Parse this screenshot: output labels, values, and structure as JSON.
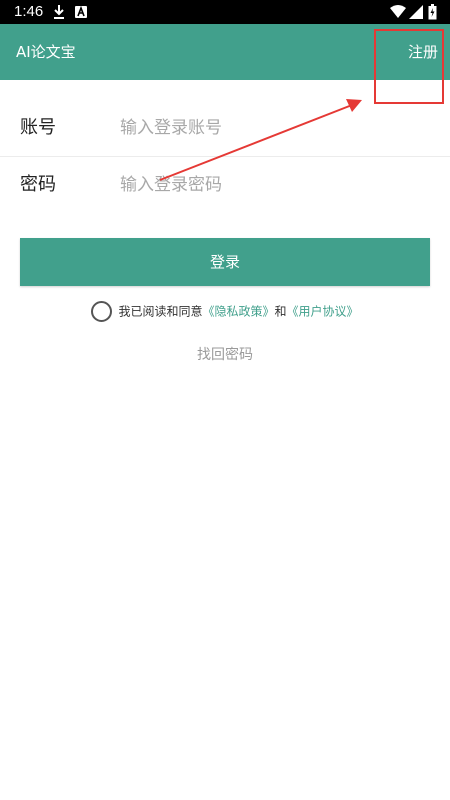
{
  "status_bar": {
    "time": "1:46",
    "icons": [
      "download-icon",
      "a-notification-icon",
      "wifi-icon",
      "signal-icon",
      "battery-icon"
    ]
  },
  "app_bar": {
    "title": "AI论文宝",
    "register_label": "注册",
    "background": "#41a08c"
  },
  "form": {
    "account": {
      "label": "账号",
      "placeholder": "输入登录账号",
      "value": ""
    },
    "password": {
      "label": "密码",
      "placeholder": "输入登录密码",
      "value": ""
    }
  },
  "login_button": {
    "label": "登录"
  },
  "agreement": {
    "checked": false,
    "prefix": "我已阅读和同意",
    "privacy_link": "《隐私政策》",
    "and": "和",
    "user_agreement_link": "《用户协议》",
    "link_color": "#41a08c"
  },
  "forgot_password": {
    "label": "找回密码"
  },
  "annotation": {
    "color": "#e53935"
  }
}
